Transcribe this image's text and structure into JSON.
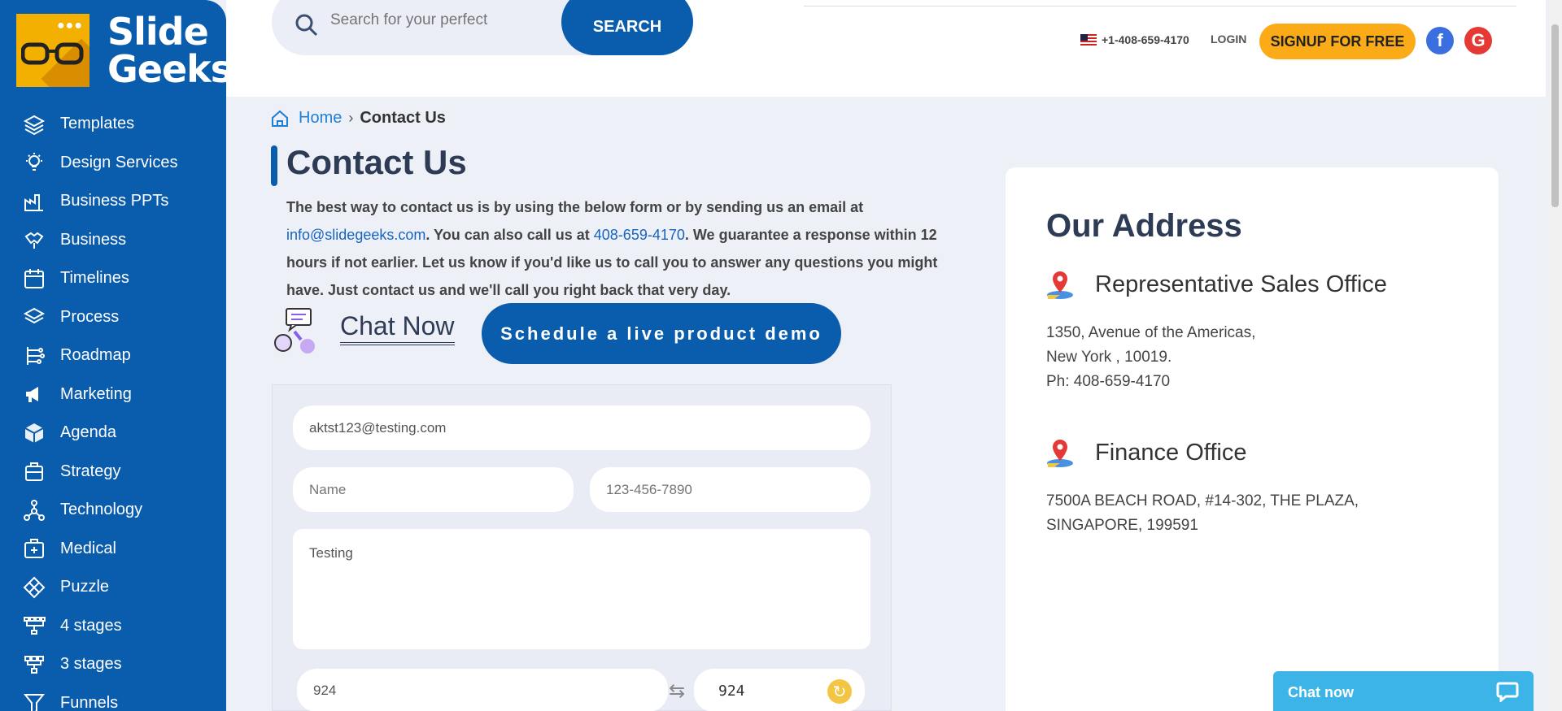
{
  "logo": {
    "line1": "Slide",
    "line2": "Geeks",
    "dots": "●●●"
  },
  "sidebar": {
    "items": [
      {
        "label": "Templates",
        "icon": "layers-icon"
      },
      {
        "label": "Design Services",
        "icon": "lightbulb-icon"
      },
      {
        "label": "Business PPTs",
        "icon": "factory-icon"
      },
      {
        "label": "Business",
        "icon": "handshake-icon"
      },
      {
        "label": "Timelines",
        "icon": "calendar-icon"
      },
      {
        "label": "Process",
        "icon": "layers-icon"
      },
      {
        "label": "Roadmap",
        "icon": "roadmap-icon"
      },
      {
        "label": "Marketing",
        "icon": "megaphone-icon"
      },
      {
        "label": "Agenda",
        "icon": "cube-icon"
      },
      {
        "label": "Strategy",
        "icon": "chess-icon"
      },
      {
        "label": "Technology",
        "icon": "network-icon"
      },
      {
        "label": "Medical",
        "icon": "medkit-icon"
      },
      {
        "label": "Puzzle",
        "icon": "puzzle-icon"
      },
      {
        "label": "4 stages",
        "icon": "stages-icon"
      },
      {
        "label": "3 stages",
        "icon": "stages-icon"
      },
      {
        "label": "Funnels",
        "icon": "funnel-icon"
      }
    ]
  },
  "header": {
    "search_placeholder": "Search for your perfect",
    "search_button": "SEARCH",
    "phone": "+1-408-659-4170",
    "login": "LOGIN",
    "signup": "SIGNUP FOR FREE",
    "facebook": "f",
    "google": "G"
  },
  "breadcrumb": {
    "home": "Home",
    "separator": "›",
    "current": "Contact Us"
  },
  "page": {
    "title": "Contact Us",
    "intro_1": "The best way to contact us is by using the below form or by sending us an email at ",
    "email_link": "info@slidegeeks.com",
    "intro_2": ". You can also call us at ",
    "phone_link": "408-659-4170",
    "intro_3": ". We guarantee a response within 12 hours if not earlier. Let us know if you'd like us to call you to answer any questions you might have. Just contact us and we'll call you right back that very day.",
    "chat_now": "Chat Now",
    "demo_button": "Schedule a live product demo"
  },
  "form": {
    "email_value": "aktst123@testing.com",
    "name_placeholder": "Name",
    "phone_placeholder": "123-456-7890",
    "message_value": "Testing",
    "captcha_input": "924",
    "captcha_code": "924",
    "swap_glyph": "⇆",
    "refresh_glyph": "↻"
  },
  "address": {
    "title": "Our Address",
    "offices": [
      {
        "name": "Representative Sales Office",
        "lines": [
          "1350, Avenue of the Americas,",
          "New York , 10019.",
          "Ph: 408-659-4170"
        ]
      },
      {
        "name": "Finance Office",
        "lines": [
          "7500A BEACH ROAD, #14-302, THE PLAZA,",
          "SINGAPORE, 199591"
        ]
      }
    ]
  },
  "chat_widget": {
    "label": "Chat now"
  },
  "colors": {
    "brand_blue": "#0a5cad",
    "accent_orange": "#fbab18",
    "chat_blue": "#3cb4e7"
  }
}
